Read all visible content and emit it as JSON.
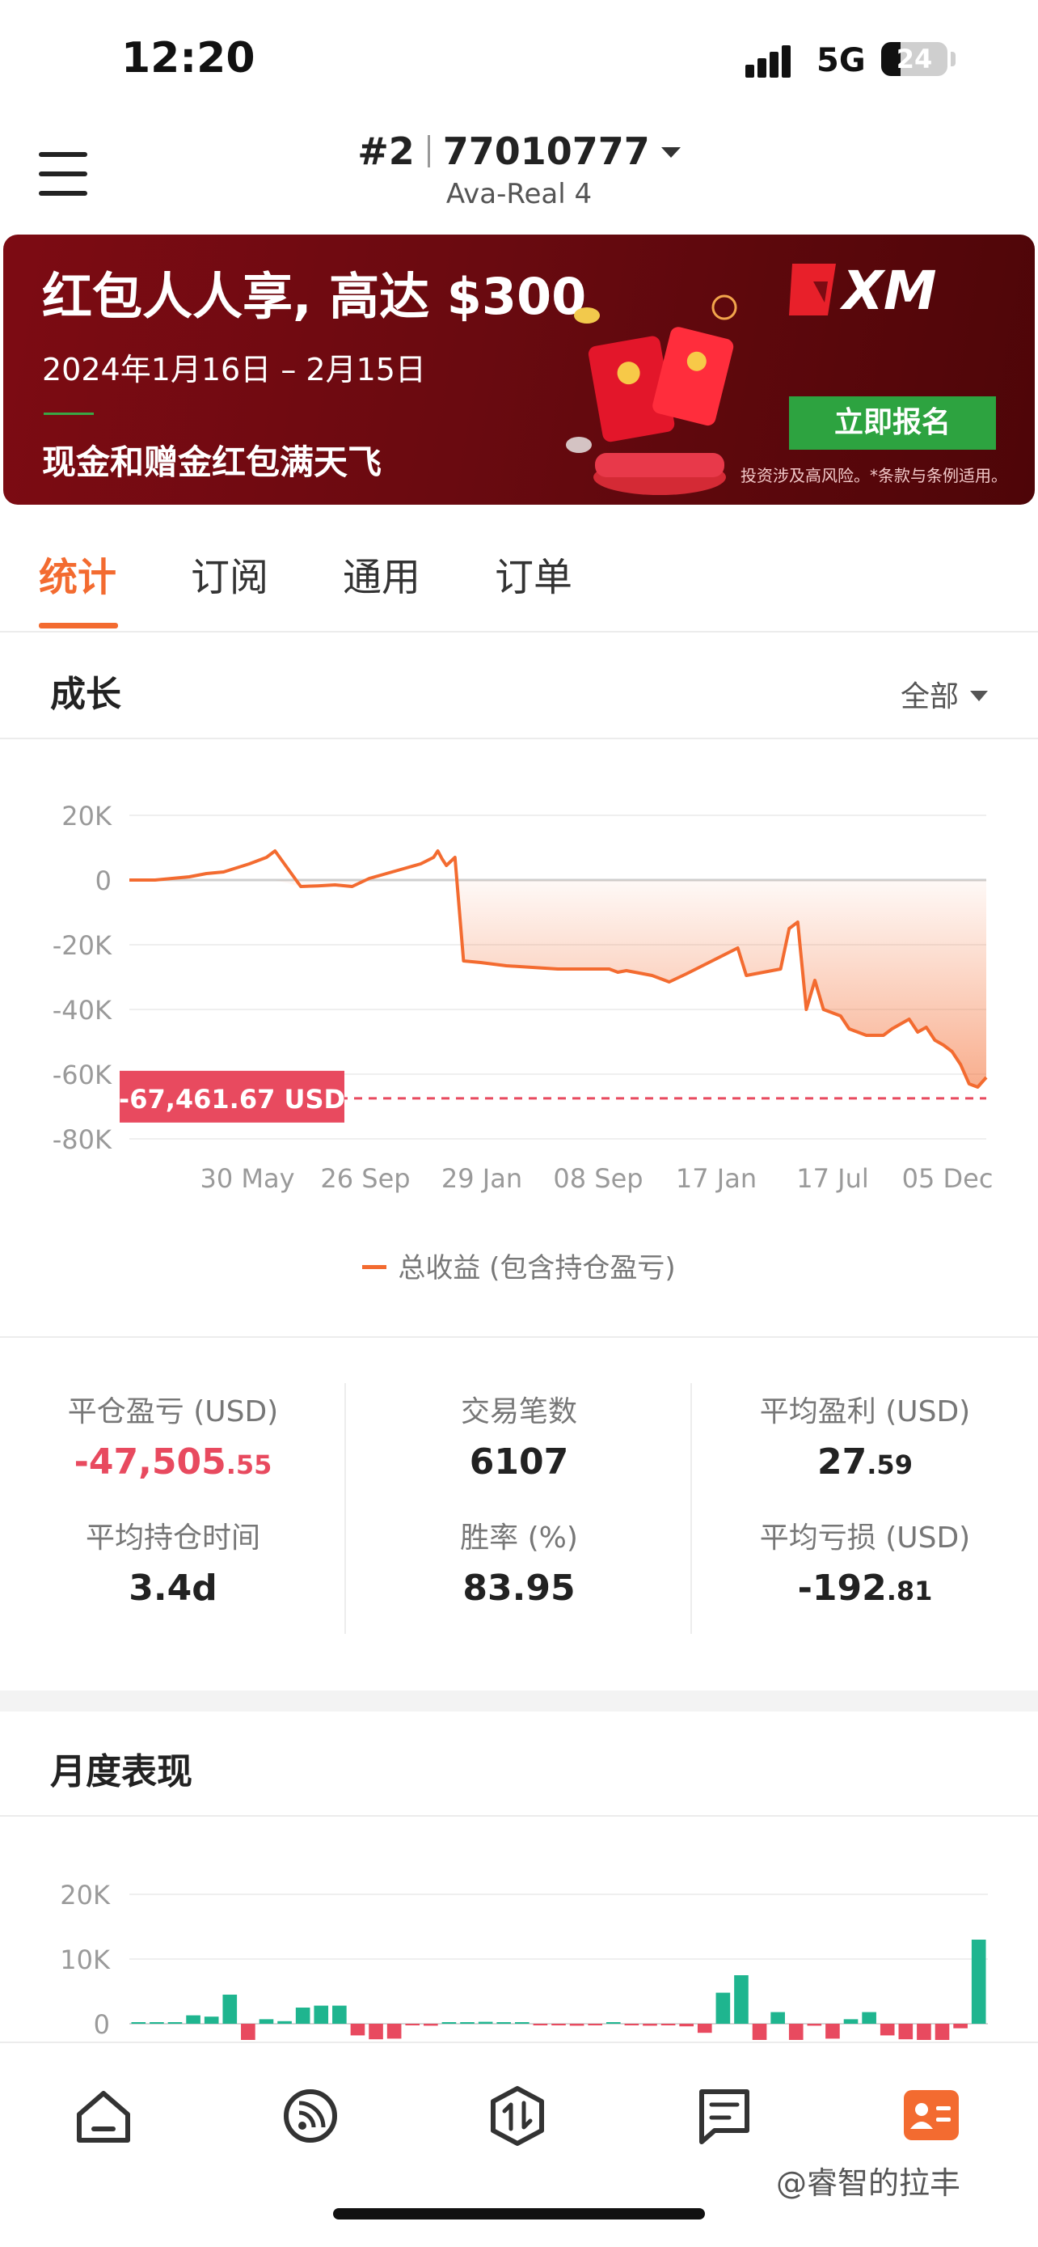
{
  "status_bar": {
    "time": "12:20",
    "network": "5G",
    "battery": "24"
  },
  "account": {
    "number": "#2",
    "id": "77010777",
    "server": "Ava-Real 4"
  },
  "banner": {
    "title": "红包人人享, 高达 $300",
    "dates": "2024年1月16日 – 2月15日",
    "subtitle": "现金和赠金红包满天飞",
    "brand": "XM",
    "cta": "立即报名",
    "disclaimer": "投资涉及高风险。*条款与条例适用。"
  },
  "tabs": [
    {
      "label": "统计",
      "active": true
    },
    {
      "label": "订阅",
      "active": false
    },
    {
      "label": "通用",
      "active": false
    },
    {
      "label": "订单",
      "active": false
    }
  ],
  "growth": {
    "title": "成长",
    "range": "全部",
    "accent": "#f36b30",
    "chart_data": {
      "type": "area",
      "title": "",
      "y_ticks": [
        "20K",
        "0",
        "-20K",
        "-40K",
        "-60K",
        "-80K"
      ],
      "ylim": [
        -80000,
        20000
      ],
      "x_ticks": [
        "30 May",
        "26 Sep",
        "29 Jan",
        "08 Sep",
        "17 Jan",
        "17 Jul",
        "05 Dec"
      ],
      "current_label": "-67,461.67 USD",
      "current_value": -67461.67,
      "legend": "总收益 (包含持仓盈亏)",
      "series": [
        {
          "name": "总收益 (包含持仓盈亏)",
          "x": [
            0,
            0.03,
            0.07,
            0.09,
            0.11,
            0.14,
            0.16,
            0.17,
            0.2,
            0.22,
            0.24,
            0.26,
            0.28,
            0.3,
            0.32,
            0.34,
            0.355,
            0.36,
            0.365,
            0.37,
            0.38,
            0.39,
            0.41,
            0.44,
            0.5,
            0.56,
            0.57,
            0.58,
            0.6,
            0.61,
            0.62,
            0.63,
            0.65,
            0.68,
            0.71,
            0.72,
            0.73,
            0.76,
            0.77,
            0.78,
            0.79,
            0.8,
            0.81,
            0.83,
            0.84,
            0.86,
            0.88,
            0.89,
            0.91,
            0.92,
            0.93,
            0.94,
            0.95,
            0.96,
            0.97,
            0.98,
            0.99,
            1.0
          ],
          "y": [
            0,
            0,
            1000,
            2000,
            2500,
            5000,
            7000,
            9000,
            -2000,
            -1800,
            -1500,
            -2000,
            500,
            2000,
            3500,
            5000,
            7000,
            9000,
            6500,
            4500,
            7000,
            -25000,
            -25500,
            -26500,
            -27500,
            -27500,
            -28500,
            -28000,
            -29000,
            -29500,
            -30500,
            -31500,
            -29000,
            -25000,
            -21000,
            -29500,
            -29000,
            -27500,
            -15000,
            -13000,
            -40000,
            -31000,
            -40000,
            -42000,
            -46000,
            -48000,
            -48000,
            -46000,
            -43000,
            -47000,
            -45500,
            -49500,
            -51000,
            -53000,
            -57000,
            -63000,
            -64000,
            -61000,
            -58000,
            -47000,
            -67461.67
          ]
        }
      ]
    }
  },
  "stats": {
    "closed_pnl": {
      "label": "平仓盈亏 (USD)",
      "int": "-47,505",
      "dec": ".55"
    },
    "trades": {
      "label": "交易笔数",
      "value": "6107"
    },
    "avg_profit": {
      "label": "平均盈利 (USD)",
      "int": "27",
      "dec": ".59"
    },
    "avg_hold": {
      "label": "平均持仓时间",
      "value": "3.4d"
    },
    "win_rate": {
      "label": "胜率 (%)",
      "value": "83.95"
    },
    "avg_loss": {
      "label": "平均亏损 (USD)",
      "int": "-192",
      "dec": ".81"
    }
  },
  "monthly": {
    "title": "月度表现",
    "positive_color": "#1fb58f",
    "negative_color": "#e84a5f",
    "chart_data": {
      "type": "bar",
      "y_ticks": [
        "20K",
        "10K",
        "0"
      ],
      "ylim": [
        0,
        20000
      ],
      "values": [
        100,
        150,
        200,
        1300,
        1100,
        4500,
        -2500,
        700,
        400,
        2500,
        2800,
        2800,
        -1800,
        -2400,
        -2300,
        -200,
        -300,
        200,
        100,
        300,
        200,
        100,
        -200,
        -200,
        -300,
        -100,
        50,
        -200,
        -300,
        -200,
        -400,
        -1400,
        4800,
        7500,
        -2500,
        1800,
        -2500,
        -300,
        -2300,
        700,
        1800,
        -1800,
        -2400,
        -2500,
        -2500,
        -700,
        13000
      ]
    }
  },
  "bottom_nav": {
    "items": [
      {
        "icon": "home-icon",
        "active": false
      },
      {
        "icon": "feed-icon",
        "active": false
      },
      {
        "icon": "trade-icon",
        "active": false
      },
      {
        "icon": "orders-icon",
        "active": false
      },
      {
        "icon": "profile-card-icon",
        "active": true
      }
    ]
  },
  "watermark": "@睿智的拉丰"
}
